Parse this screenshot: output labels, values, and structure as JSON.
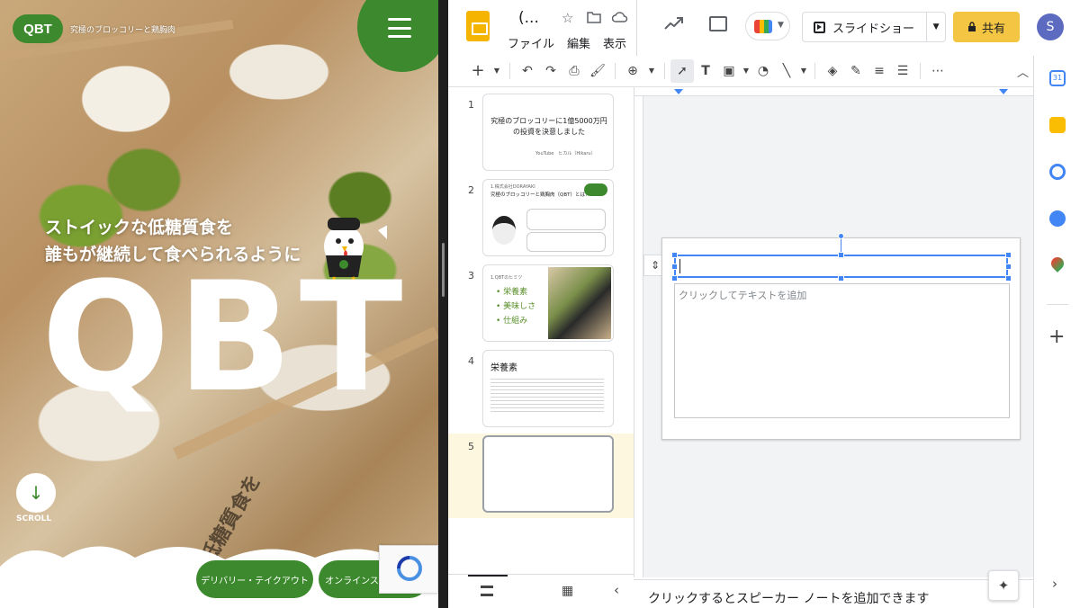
{
  "website": {
    "logo_text": "QBT",
    "logo_tagline": "究極のブロッコリーと鶏胸肉",
    "tagline_line1": "ストイックな低糖質食を",
    "tagline_line2": "誰もが継続して食べられるように",
    "hero_logo": "QBT",
    "scroll_label": "SCROLL",
    "delivery_button": "デリバリー・テイクアウト",
    "online_store_button": "オンラインストア",
    "box_print": "低糖質食を",
    "colors": {
      "brand_green": "#3d8a2e"
    }
  },
  "slides_app": {
    "doc_title": "(...",
    "menus": [
      "ファイル",
      "編集",
      "表示"
    ],
    "slideshow_label": "スライドショー",
    "share_label": "共有",
    "avatar_initial": "S",
    "toolbar_icons": [
      "add-icon",
      "dropdown-icon",
      "undo-icon",
      "redo-icon",
      "print-icon",
      "paint-format-icon",
      "zoom-icon",
      "dropdown-icon",
      "select-icon",
      "textbox-icon",
      "image-icon",
      "dropdown-icon",
      "shape-icon",
      "line-icon",
      "dropdown-icon",
      "fill-color-icon",
      "border-color-icon",
      "border-weight-icon",
      "border-dash-icon",
      "more-icon",
      "collapse-icon"
    ],
    "slides": [
      {
        "num": "1",
        "title": "究極のブロッコリーに1億5000万円の投資を決意しました",
        "subtitle": "YouTube　ヒカル（Hikaru）"
      },
      {
        "num": "2",
        "title": "究極のブロッコリーと鶏胸肉（QBT）とは？",
        "header": "1.株式会社DORAYAKI"
      },
      {
        "num": "3",
        "header": "1.QBTのヒミツ",
        "items": [
          "栄養素",
          "美味しさ",
          "仕組み"
        ]
      },
      {
        "num": "4",
        "title": "栄養素"
      },
      {
        "num": "5",
        "title": ""
      }
    ],
    "active_slide": 5,
    "body_placeholder": "クリックしてテキストを追加",
    "speaker_notes_placeholder": "クリックするとスピーカー ノートを追加できます",
    "side_panel_icons": [
      "calendar-icon",
      "keep-icon",
      "tasks-icon",
      "contacts-icon",
      "maps-icon",
      "add-icon"
    ],
    "calendar_day": "31"
  }
}
